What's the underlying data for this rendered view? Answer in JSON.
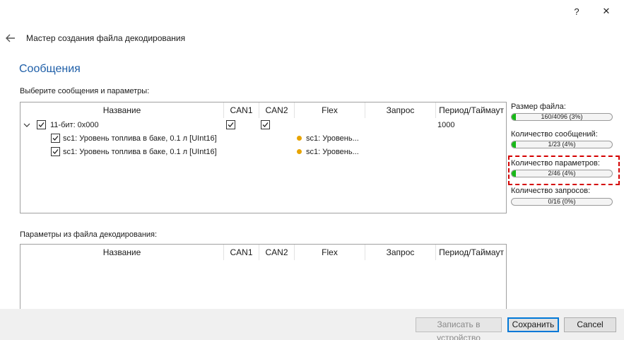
{
  "window": {
    "help_label": "?",
    "close_label": "✕",
    "title": "Мастер создания файла декодирования"
  },
  "page": {
    "title": "Сообщения",
    "messages_label": "Выберите сообщения и параметры:",
    "file_params_label": "Параметры из файла декодирования:"
  },
  "columns": [
    "Название",
    "CAN1",
    "CAN2",
    "Flex",
    "Запрос",
    "Период/Таймаут"
  ],
  "messages_table": {
    "group": {
      "name": "11-бит: 0x000",
      "can1": true,
      "can2": true,
      "period": "1000",
      "checked": true,
      "expanded": true
    },
    "params": [
      {
        "name": "sc1: Уровень топлива в баке, 0.1 л [UInt16]",
        "flex": "sc1: Уровень...",
        "checked": true
      },
      {
        "name": "sc1: Уровень топлива в баке, 0.1 л [UInt16]",
        "flex": "sc1: Уровень...",
        "checked": true
      }
    ]
  },
  "stats": [
    {
      "label": "Размер файла:",
      "value": "160/4096 (3%)",
      "fraction": 0.039
    },
    {
      "label": "Количество сообщений:",
      "value": "1/23 (4%)",
      "fraction": 0.043
    },
    {
      "label": "Количество параметров:",
      "value": "2/46 (4%)",
      "fraction": 0.043
    },
    {
      "label": "Количество запросов:",
      "value": "0/16 (0%)",
      "fraction": 0
    }
  ],
  "footer": {
    "write_label": "Записать в устройство",
    "save_label": "Сохранить",
    "cancel_label": "Cancel"
  },
  "colors": {
    "accent_title": "#1f5fa8",
    "progress_fill": "#17b817",
    "highlight_border": "#d40000",
    "flex_dot": "#e8a400"
  }
}
